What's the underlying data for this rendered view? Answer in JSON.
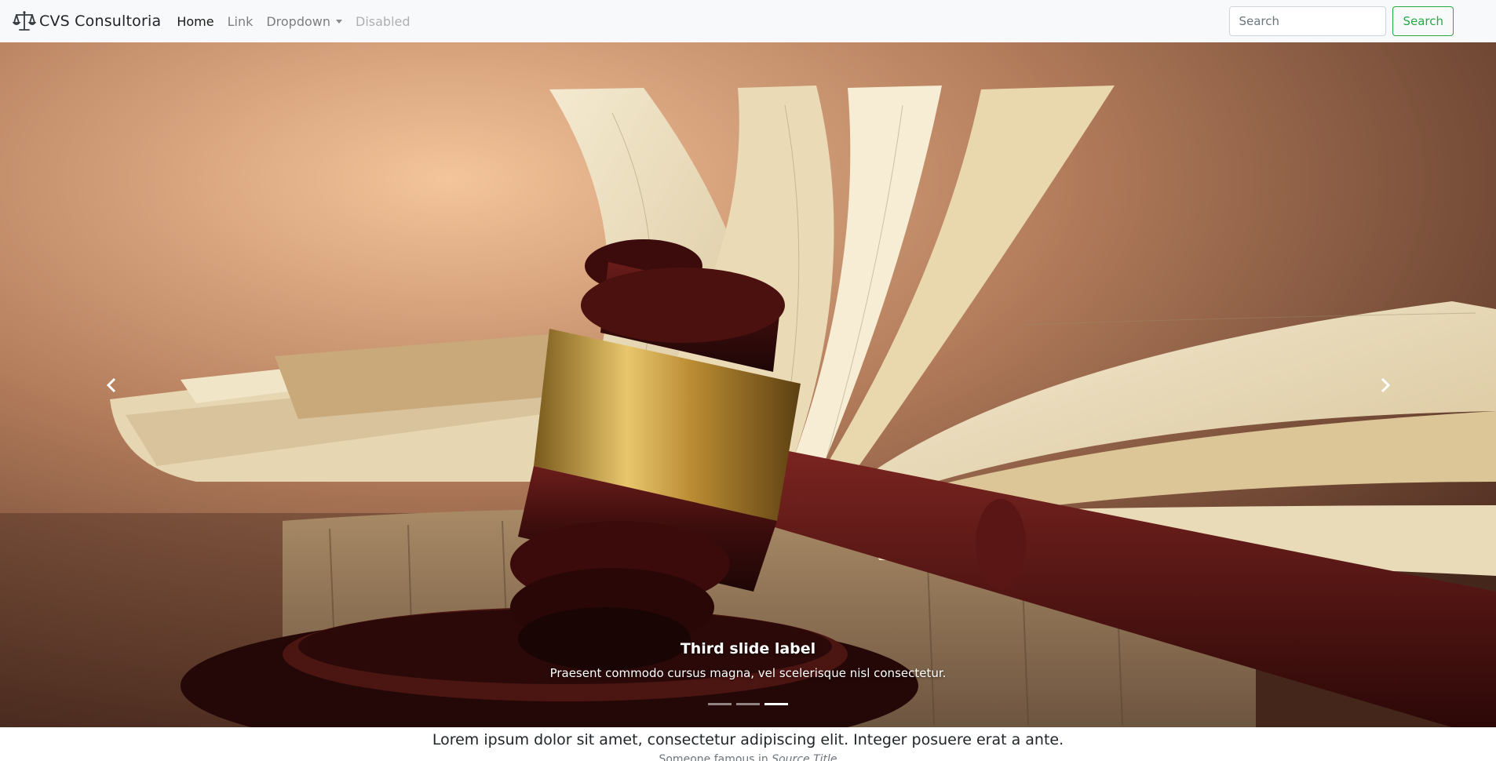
{
  "navbar": {
    "brand": "CVS Consultoria",
    "links": [
      {
        "label": "Home",
        "state": "active"
      },
      {
        "label": "Link",
        "state": "normal"
      },
      {
        "label": "Dropdown",
        "state": "dropdown"
      },
      {
        "label": "Disabled",
        "state": "disabled"
      }
    ],
    "search_placeholder": "Search",
    "search_button": "Search",
    "accent_color": "#28a745",
    "brand_icon": "scales-of-justice-icon"
  },
  "carousel": {
    "caption_title": "Third slide label",
    "caption_text": "Praesent commodo cursus magna, vel scelerisque nisl consectetur.",
    "slide_count": 3,
    "active_slide": 3,
    "prev_icon": "chevron-left-icon",
    "next_icon": "chevron-right-icon"
  },
  "quote": {
    "text": "Lorem ipsum dolor sit amet, consectetur adipiscing elit. Integer posuere erat a ante.",
    "footer_prefix": "Someone famous in ",
    "footer_cite": "Source Title"
  }
}
